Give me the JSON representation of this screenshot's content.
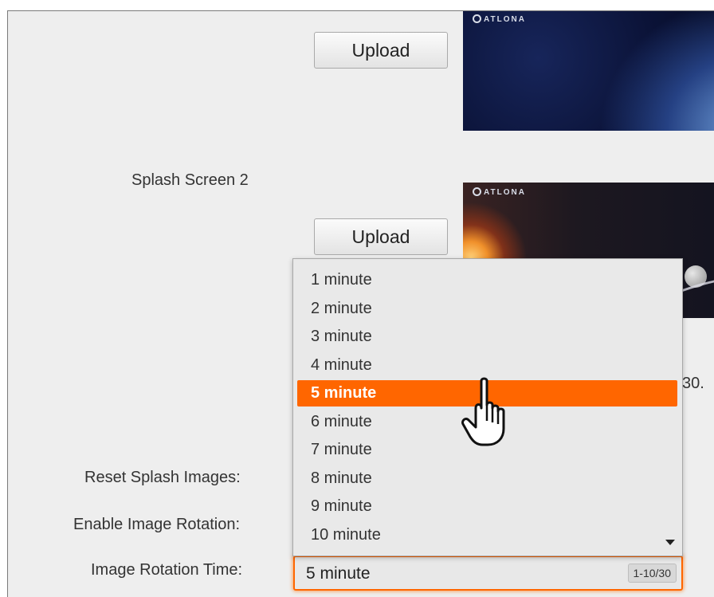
{
  "splash": {
    "upload_label": "Upload",
    "screen2_label": "Splash Screen 2",
    "thumb_logo_text": "ATLONA",
    "clipped_text": "30."
  },
  "settings": {
    "reset_label": "Reset Splash Images:",
    "enable_rotation_label": "Enable Image Rotation:",
    "rotation_time_label": "Image Rotation Time:"
  },
  "rotation_select": {
    "value": "5 minute",
    "range_badge": "1-10/30",
    "selected_index": 4,
    "options": [
      "1 minute",
      "2 minute",
      "3 minute",
      "4 minute",
      "5 minute",
      "6 minute",
      "7 minute",
      "8 minute",
      "9 minute",
      "10 minute"
    ]
  },
  "colors": {
    "accent": "#ff6600",
    "panel_bg": "#eeeeee"
  },
  "icons": {
    "cursor": "hand-pointer-icon",
    "scroll": "scroll-down-arrow-icon"
  }
}
